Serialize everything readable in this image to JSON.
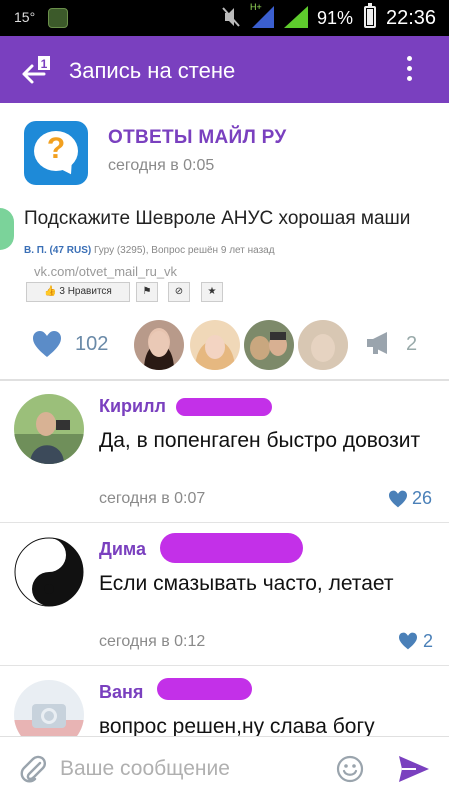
{
  "status_bar": {
    "temperature": "15°",
    "battery_percent": "91%",
    "time": "22:36",
    "network": "H+"
  },
  "topbar": {
    "title": "Запись на стене",
    "back_icon": "back-arrow-icon",
    "badge": "1",
    "menu_icon": "more-vertical-icon"
  },
  "post": {
    "author": "ОТВЕТЫ МАЙЛ РУ",
    "date": "сегодня в 0:05",
    "text": "Подскажите Шевроле АНУС хорошая маши",
    "meta_user": "В. П. (47 RUS)",
    "meta_rest": " Гуру (3295), Вопрос решён 9 лет назад",
    "link": "vk.com/otvet_mail_ru_vk",
    "mini_like_label": "3 Нравится",
    "likes": "102",
    "shares": "2",
    "colors": {
      "accent": "#7a40bf",
      "logo_bg": "#1e8ad8",
      "heart": "#5b8cc8"
    }
  },
  "comments": [
    {
      "name": "Кирилл",
      "text": "Да, в попенгаген быстро довозит",
      "date": "сегодня в 0:07",
      "likes": "26"
    },
    {
      "name": "Дима",
      "text": "Если смазывать часто, летает",
      "date": "сегодня в 0:12",
      "likes": "2"
    },
    {
      "name": "Ваня",
      "text": "вопрос решен,ну слава богу",
      "date": "",
      "likes": ""
    }
  ],
  "input": {
    "placeholder": "Ваше сообщение"
  }
}
